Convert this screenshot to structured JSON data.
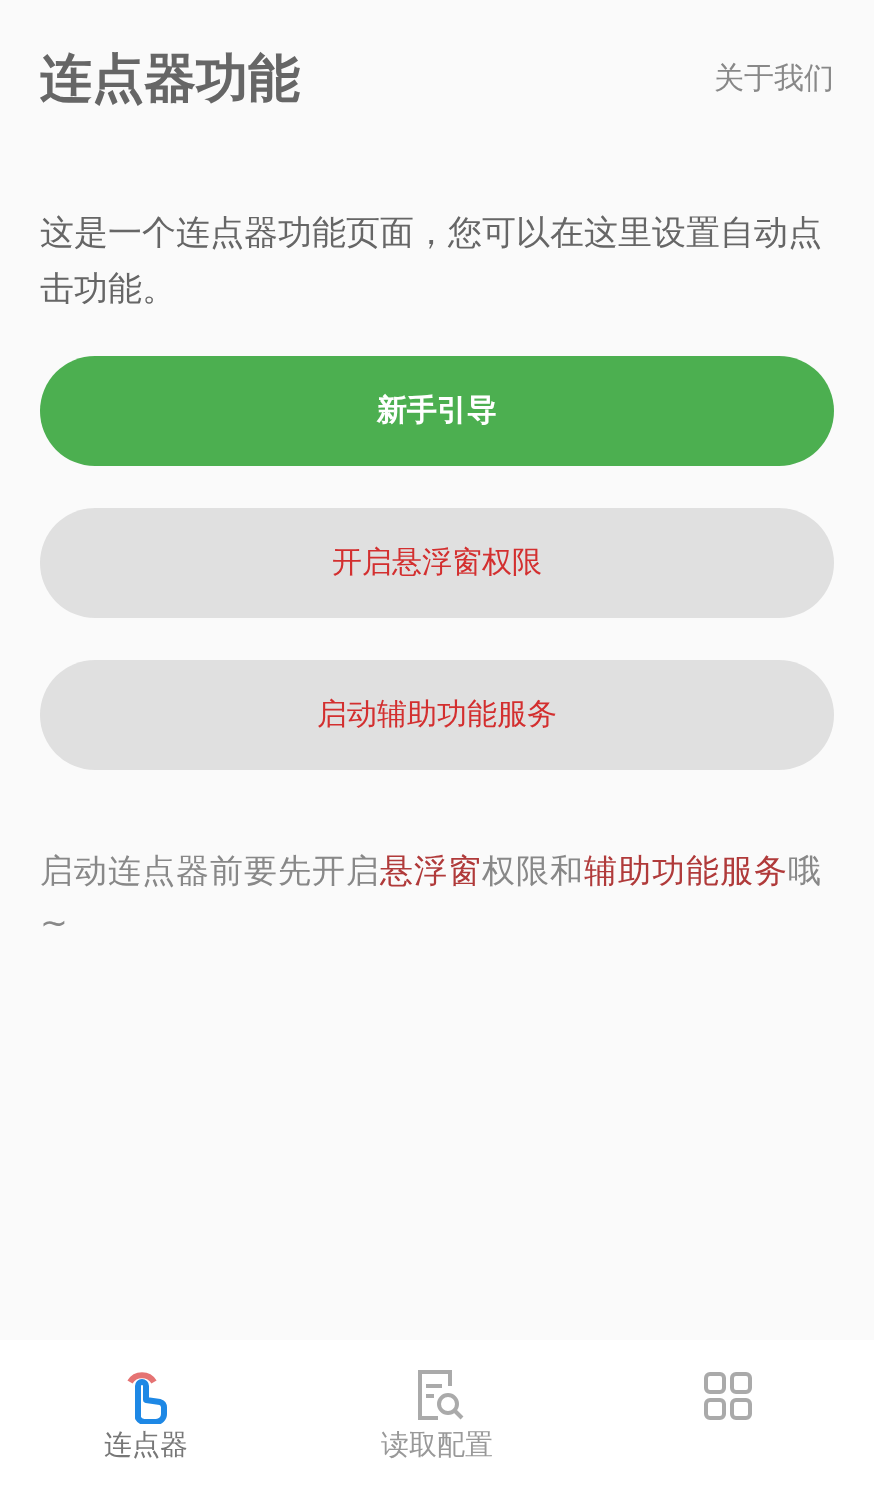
{
  "header": {
    "title": "连点器功能",
    "about_link": "关于我们"
  },
  "description": "这是一个连点器功能页面，您可以在这里设置自动点击功能。",
  "buttons": [
    {
      "label": "新手引导",
      "kind": "primary"
    },
    {
      "label": "开启悬浮窗权限",
      "kind": "secondary"
    },
    {
      "label": "启动辅助功能服务",
      "kind": "secondary"
    }
  ],
  "note": [
    {
      "text": "启动连点器前要先开启",
      "highlight": false
    },
    {
      "text": "悬浮窗",
      "highlight": true
    },
    {
      "text": "权限和",
      "highlight": false
    },
    {
      "text": "辅助功能服务",
      "highlight": true
    },
    {
      "text": "哦~",
      "highlight": false
    }
  ],
  "tabs": [
    {
      "label": "连点器",
      "kind": "clicker",
      "selected": true
    },
    {
      "label": "读取配置",
      "kind": "config",
      "selected": false
    },
    {
      "kind": "grid",
      "selected": false
    }
  ]
}
